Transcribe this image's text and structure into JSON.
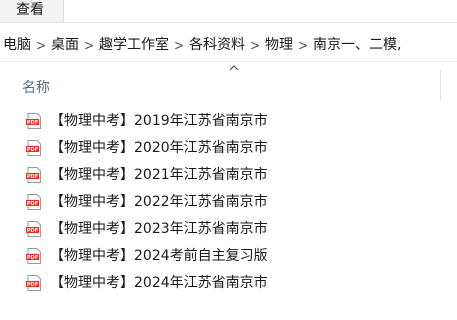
{
  "ribbon": {
    "view_tab": "查看"
  },
  "breadcrumb": [
    "电脑",
    "桌面",
    "趣学工作室",
    "各科资料",
    "物理",
    "南京一、二模,"
  ],
  "columns": {
    "name_header": "名称"
  },
  "files": [
    {
      "name": "【物理中考】2019年江苏省南京市",
      "icon": "pdf-icon"
    },
    {
      "name": "【物理中考】2020年江苏省南京市",
      "icon": "pdf-icon"
    },
    {
      "name": "【物理中考】2021年江苏省南京市",
      "icon": "pdf-icon"
    },
    {
      "name": "【物理中考】2022年江苏省南京市",
      "icon": "pdf-icon"
    },
    {
      "name": "【物理中考】2023年江苏省南京市",
      "icon": "pdf-icon"
    },
    {
      "name": "【物理中考】2024考前自主复习版",
      "icon": "pdf-icon"
    },
    {
      "name": "【物理中考】2024年江苏省南京市",
      "icon": "pdf-icon"
    }
  ],
  "icon_labels": {
    "pdf": "PDF"
  },
  "colors": {
    "pdf_red": "#d9342b",
    "header_text": "#5b6b7c"
  }
}
